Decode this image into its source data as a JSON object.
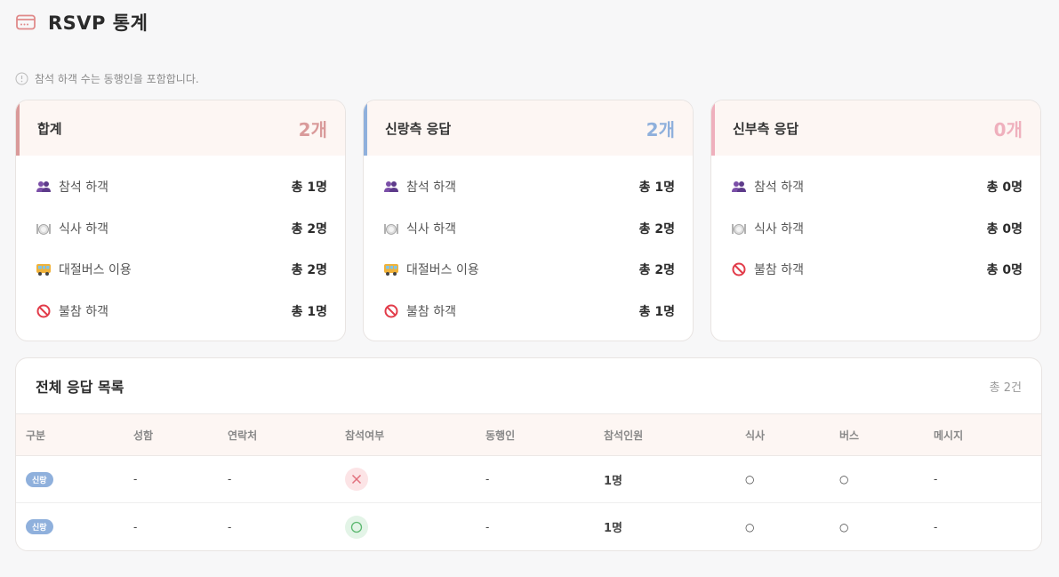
{
  "page": {
    "title": "RSVP 통계"
  },
  "notice": "참석 하객 수는 동행인을 포함합니다.",
  "cards": [
    {
      "title": "합계",
      "count": "2개",
      "accent": "#d99a9a",
      "rows": [
        {
          "icon": "people-icon",
          "label": "참석 하객",
          "value": "총 1명"
        },
        {
          "icon": "meal-icon",
          "label": "식사 하객",
          "value": "총 2명"
        },
        {
          "icon": "bus-icon",
          "label": "대절버스 이용",
          "value": "총 2명"
        },
        {
          "icon": "prohibited-icon",
          "label": "불참 하객",
          "value": "총 1명"
        }
      ]
    },
    {
      "title": "신랑측 응답",
      "count": "2개",
      "accent": "#8fb0dc",
      "rows": [
        {
          "icon": "people-icon",
          "label": "참석 하객",
          "value": "총 1명"
        },
        {
          "icon": "meal-icon",
          "label": "식사 하객",
          "value": "총 2명"
        },
        {
          "icon": "bus-icon",
          "label": "대절버스 이용",
          "value": "총 2명"
        },
        {
          "icon": "prohibited-icon",
          "label": "불참 하객",
          "value": "총 1명"
        }
      ]
    },
    {
      "title": "신부측 응답",
      "count": "0개",
      "accent": "#efb0bd",
      "rows": [
        {
          "icon": "people-icon",
          "label": "참석 하객",
          "value": "총 0명"
        },
        {
          "icon": "meal-icon",
          "label": "식사 하객",
          "value": "총 0명"
        },
        {
          "icon": "prohibited-icon",
          "label": "불참 하객",
          "value": "총 0명"
        }
      ]
    }
  ],
  "list": {
    "title": "전체 응답 목록",
    "total": "총 2건",
    "columns": [
      "구분",
      "성함",
      "연락처",
      "참석여부",
      "동행인",
      "참석인원",
      "식사",
      "버스",
      "메시지"
    ],
    "rows": [
      {
        "side": "신랑",
        "name": "-",
        "phone": "-",
        "attend": "no",
        "companion": "-",
        "headcount": "1명",
        "meal": "○",
        "bus": "○",
        "message": "-"
      },
      {
        "side": "신랑",
        "name": "-",
        "phone": "-",
        "attend": "yes",
        "companion": "-",
        "headcount": "1명",
        "meal": "○",
        "bus": "○",
        "message": "-"
      }
    ]
  }
}
